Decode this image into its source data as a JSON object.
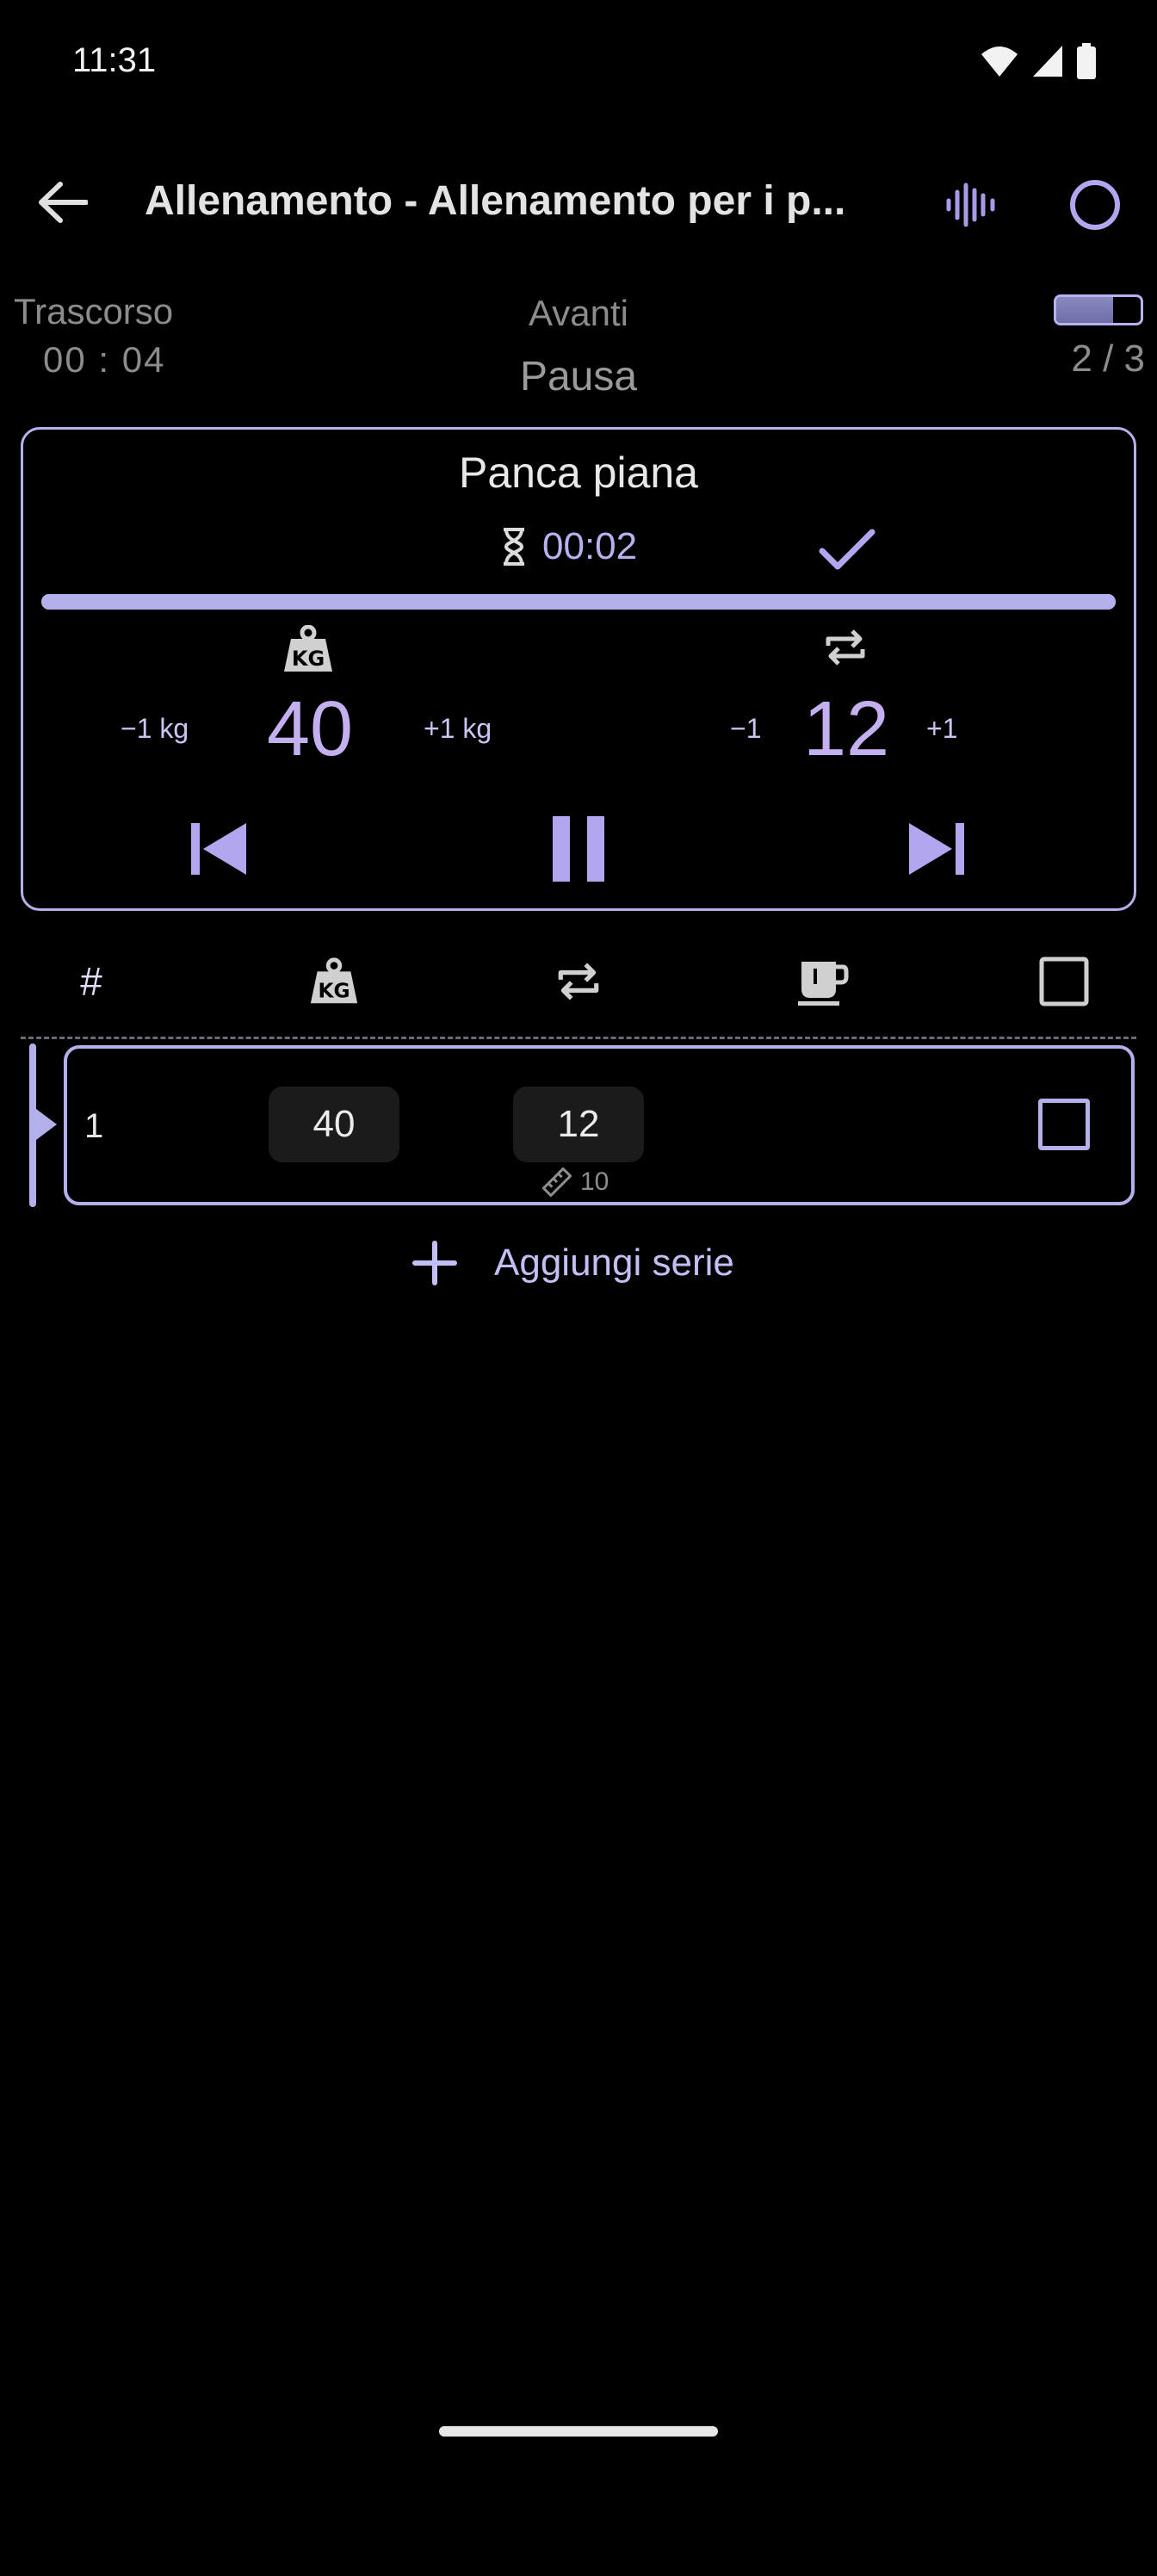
{
  "status_bar": {
    "time": "11:31",
    "icons": [
      "wifi-icon",
      "signal-icon",
      "battery-icon"
    ]
  },
  "app_bar": {
    "title": "Allenamento - Allenamento per i p...",
    "back_icon": "arrow-back-icon",
    "actions": [
      "waveform-icon",
      "circle-icon"
    ]
  },
  "summary": {
    "elapsed_label": "Trascorso",
    "elapsed_value": "00 : 04",
    "next_label": "Avanti",
    "next_value": "Pausa",
    "progress_count": "2 / 3",
    "progress_fraction": 0.67
  },
  "exercise": {
    "name": "Panca piana",
    "timer": "00:02",
    "timer_progress": 1.0,
    "weight": {
      "minus_label": "−1 kg",
      "value": "40",
      "plus_label": "+1 kg"
    },
    "reps": {
      "minus_label": "−1",
      "value": "12",
      "plus_label": "+1"
    },
    "controls": [
      "skip-previous-icon",
      "pause-icon",
      "skip-next-icon"
    ]
  },
  "table": {
    "header": {
      "number": "#",
      "columns": [
        "kg-weight-icon",
        "repeat-icon",
        "coffee-cup-icon",
        "checkbox-icon"
      ]
    },
    "rows": [
      {
        "number": "1",
        "weight": "40",
        "reps": "12",
        "previous_reps": "10",
        "done": false
      }
    ],
    "add_set_label": "Aggiungi serie"
  },
  "colors": {
    "accent": "#b3b0ec",
    "accent_text": "#c4b0f0",
    "background": "#000000",
    "muted": "#8c8c8c"
  }
}
